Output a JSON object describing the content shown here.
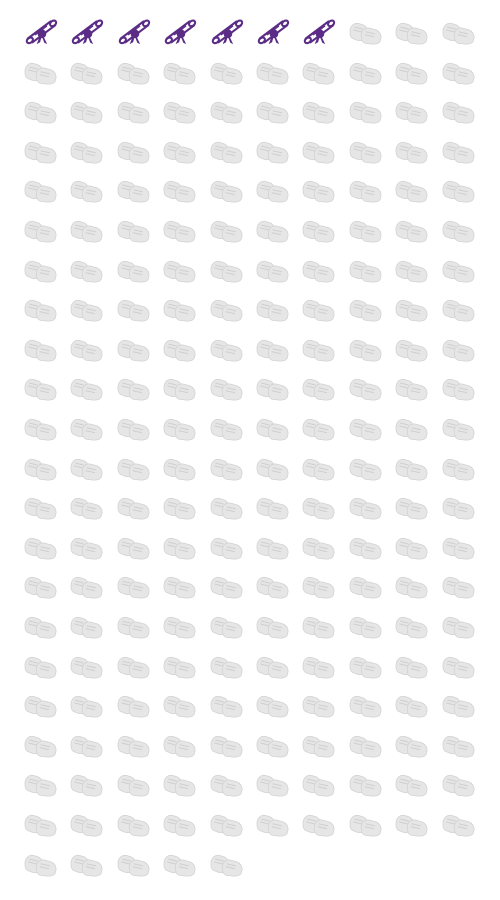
{
  "chart_data": {
    "type": "pictograph",
    "columns": 10,
    "total_icons": 215,
    "series": [
      {
        "icon": "diploma-scroll-icon",
        "count": 7,
        "color": "#5b2c86"
      },
      {
        "icon": "baby-shoes-icon",
        "count": 208,
        "color": "#e6e6e6"
      }
    ]
  }
}
